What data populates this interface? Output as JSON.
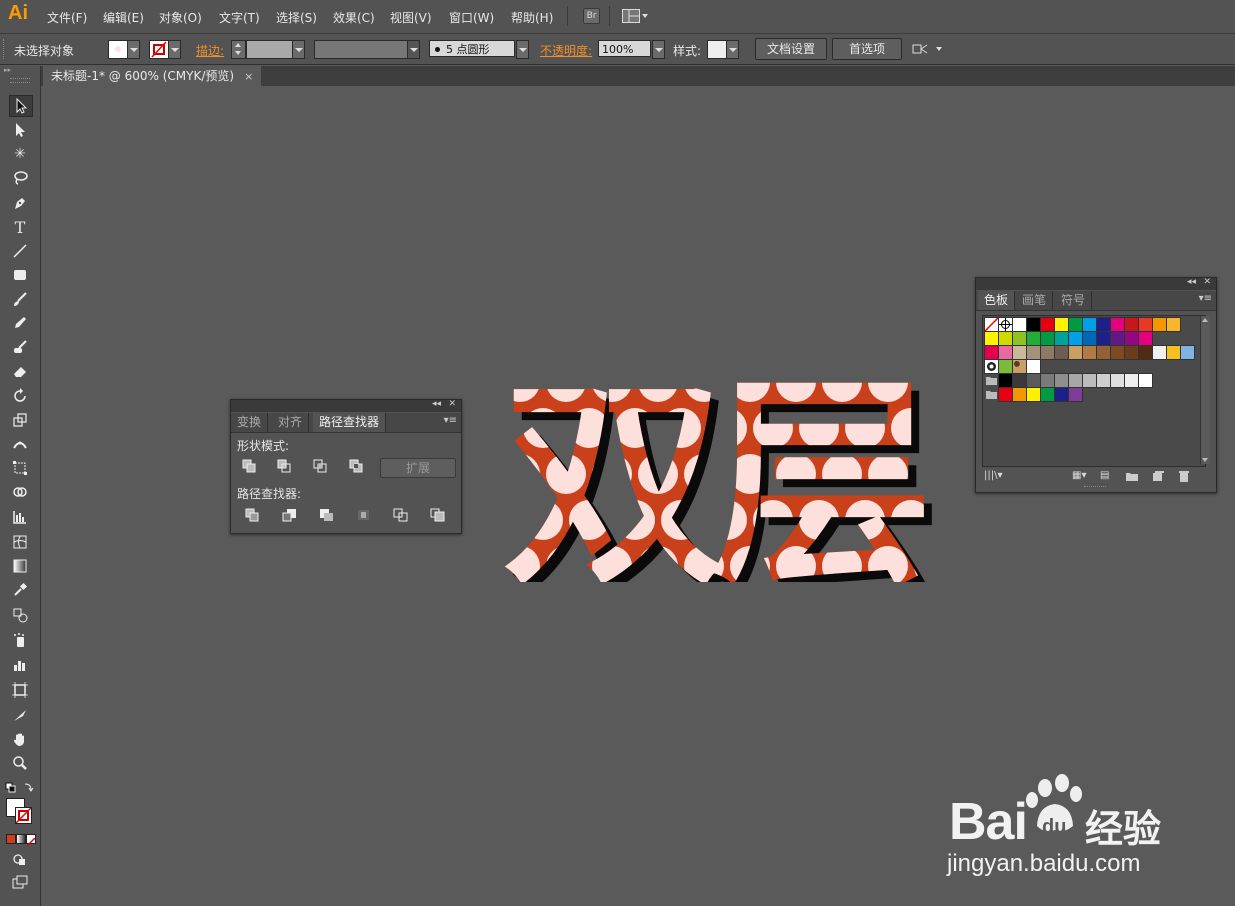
{
  "app": {
    "logo": "Ai",
    "menu": [
      "文件(F)",
      "编辑(E)",
      "对象(O)",
      "文字(T)",
      "选择(S)",
      "效果(C)",
      "视图(V)",
      "窗口(W)",
      "帮助(H)"
    ],
    "bridge_label": "Br"
  },
  "control_bar": {
    "selection_status": "未选择对象",
    "stroke_label": "描边:",
    "brush_value": "5 点圆形",
    "opacity_label": "不透明度:",
    "opacity_value": "100%",
    "style_label": "样式:",
    "doc_setup_button": "文档设置",
    "preferences_button": "首选项"
  },
  "document": {
    "tab_title": "未标题-1* @ 600% (CMYK/预览)",
    "close_glyph": "×"
  },
  "pathfinder_panel": {
    "tabs": [
      "变换",
      "对齐",
      "路径查找器"
    ],
    "active_tab": 2,
    "shape_modes_label": "形状模式:",
    "expand_button": "扩展",
    "pathfinders_label": "路径查找器:"
  },
  "swatches_panel": {
    "tabs": [
      "色板",
      "画笔",
      "符号"
    ],
    "active_tab": 0,
    "rows": [
      [
        "none",
        "registration",
        "#ffffff",
        "#000000",
        "#e60012",
        "#fff100",
        "#009944",
        "#00a0e9",
        "#1d2088",
        "#e4007f",
        "#c7161e",
        "#e83828",
        "#f39800",
        "#f8b62d"
      ],
      [
        "#fff100",
        "#cfdb00",
        "#8fc31f",
        "#22ac38",
        "#009944",
        "#00a29a",
        "#00a0e9",
        "#0068b7",
        "#1d2088",
        "#601986",
        "#920783",
        "#e4007f"
      ],
      [
        "#e5004f",
        "#ea68a2",
        "#c9b99a",
        "#a4917b",
        "#8c7966",
        "#6f5e50",
        "#c8a063",
        "#b07c43",
        "#946134",
        "#7e4a24",
        "#6b3d1c",
        "#4f2d15",
        "#f0f0f0",
        "#f6c11e",
        "#7fb2e5"
      ],
      [
        "pattern",
        "grass",
        "leopard",
        "#ffffff"
      ],
      [
        "folder",
        "#000000",
        "#3a3a3a",
        "#5a5a5a",
        "#7a7a7a",
        "#8f8f8f",
        "#a7a7a7",
        "#bcbcbc",
        "#cfcfcf",
        "#e0e0e0",
        "#efefef",
        "#ffffff"
      ],
      [
        "folder",
        "#e60012",
        "#f39800",
        "#fff100",
        "#009944",
        "#1d2088",
        "#7d3c98"
      ]
    ]
  },
  "artwork": {
    "text": "双层",
    "fill_color": "#c9401a",
    "shadow_color": "#0a0a0a",
    "dot_color": "#fde0dc"
  },
  "watermark": {
    "brand_latin": "Bai",
    "brand_du": "du",
    "brand_cn": "经验",
    "url": "jingyan.baidu.com"
  },
  "colors": {
    "workspace": "#5a5a5a",
    "chrome": "#535353",
    "accent": "#ff9a00"
  }
}
